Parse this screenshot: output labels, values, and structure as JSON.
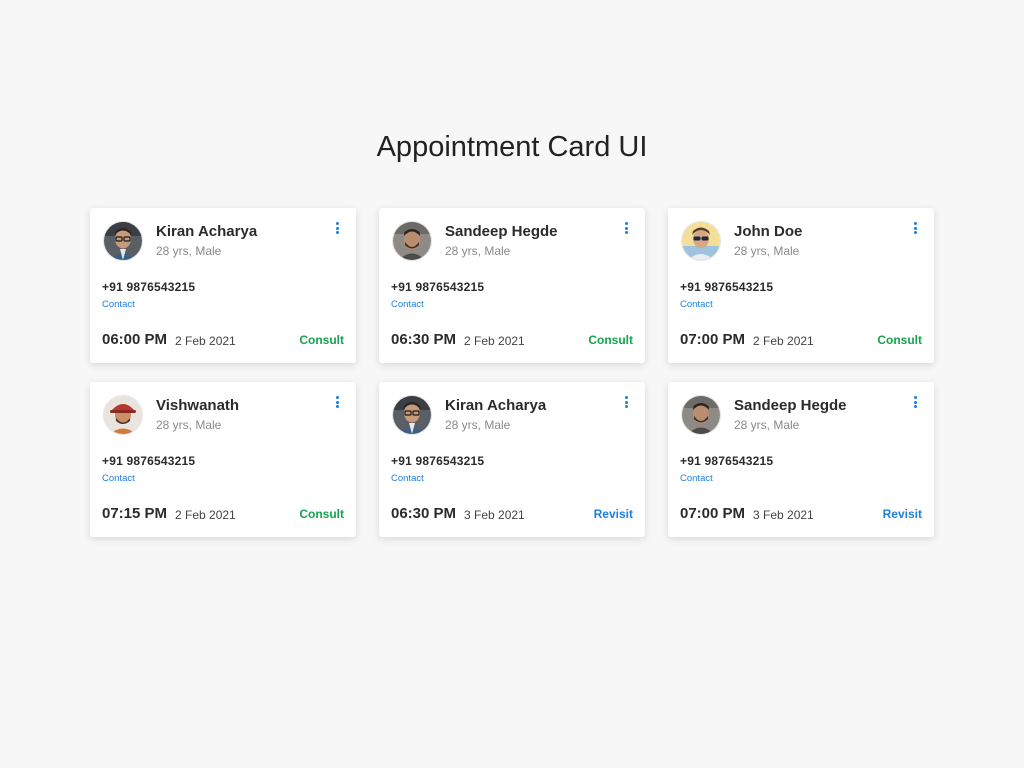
{
  "page": {
    "title": "Appointment Card UI"
  },
  "colors": {
    "background": "#f7f7f7",
    "card": "#ffffff",
    "accent_blue": "#1e7fe0",
    "consult_green": "#14a44d",
    "text_dark": "#2b2b2b",
    "text_muted": "#8a8a8a"
  },
  "cards": [
    {
      "name": "Kiran Acharya",
      "meta": "28 yrs, Male",
      "phone": "+91 9876543215",
      "contact_label": "Contact",
      "time": "06:00 PM",
      "date": "2 Feb 2021",
      "action": "Consult",
      "action_type": "consult",
      "avatar_icon": "avatar-man-glasses-icon"
    },
    {
      "name": "Sandeep Hegde",
      "meta": "28 yrs, Male",
      "phone": "+91 9876543215",
      "contact_label": "Contact",
      "time": "06:30 PM",
      "date": "2 Feb 2021",
      "action": "Consult",
      "action_type": "consult",
      "avatar_icon": "avatar-man-beard-icon"
    },
    {
      "name": "John Doe",
      "meta": "28 yrs, Male",
      "phone": "+91 9876543215",
      "contact_label": "Contact",
      "time": "07:00 PM",
      "date": "2 Feb 2021",
      "action": "Consult",
      "action_type": "consult",
      "avatar_icon": "avatar-man-sunglasses-icon"
    },
    {
      "name": "Vishwanath",
      "meta": "28 yrs, Male",
      "phone": "+91 9876543215",
      "contact_label": "Contact",
      "time": "07:15 PM",
      "date": "2 Feb 2021",
      "action": "Consult",
      "action_type": "consult",
      "avatar_icon": "avatar-man-hat-icon"
    },
    {
      "name": "Kiran Acharya",
      "meta": "28 yrs, Male",
      "phone": "+91 9876543215",
      "contact_label": "Contact",
      "time": "06:30 PM",
      "date": "3 Feb 2021",
      "action": "Revisit",
      "action_type": "revisit",
      "avatar_icon": "avatar-man-glasses-icon"
    },
    {
      "name": "Sandeep Hegde",
      "meta": "28 yrs, Male",
      "phone": "+91 9876543215",
      "contact_label": "Contact",
      "time": "07:00 PM",
      "date": "3 Feb 2021",
      "action": "Revisit",
      "action_type": "revisit",
      "avatar_icon": "avatar-man-beard-icon"
    }
  ]
}
